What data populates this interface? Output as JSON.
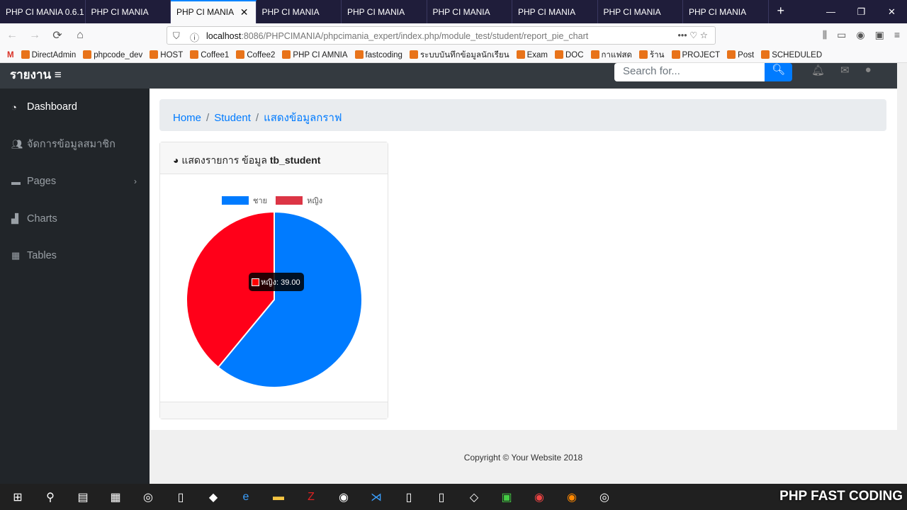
{
  "browser": {
    "tabs": [
      "PHP CI MANIA 0.6.1",
      "PHP CI MANIA",
      "PHP CI MANIA",
      "PHP CI MANIA",
      "PHP CI MANIA",
      "PHP CI MANIA",
      "PHP CI MANIA",
      "PHP CI MANIA",
      "PHP CI MANIA"
    ],
    "active_tab": 2,
    "url_host": "localhost",
    "url_rest": ":8086/PHPCIMANIA/phpcimania_expert/index.php/module_test/student/report_pie_chart",
    "bookmarks": [
      "DirectAdmin",
      "phpcode_dev",
      "HOST",
      "Coffee1",
      "Coffee2",
      "PHP CI AMNIA",
      "fastcoding",
      "ระบบบันทึกข้อมูลนักเรียน",
      "Exam",
      "DOC",
      "กาแฟสด",
      "ร้าน",
      "PROJECT",
      "Post",
      "SCHEDULED"
    ]
  },
  "topbar": {
    "brand": "รายงาน",
    "search_placeholder": "Search for..."
  },
  "sidebar": {
    "items": [
      {
        "label": "Dashboard",
        "icon": "tachometer-icon"
      },
      {
        "label": "จัดการข้อมูลสมาชิก",
        "icon": "users-icon"
      },
      {
        "label": "Pages",
        "icon": "folder-icon"
      },
      {
        "label": "Charts",
        "icon": "chart-area-icon"
      },
      {
        "label": "Tables",
        "icon": "table-icon"
      }
    ]
  },
  "breadcrumb": {
    "home": "Home",
    "student": "Student",
    "current": "แสดงข้อมูลกราฟ"
  },
  "card": {
    "title_prefix": "แสดงรายการ ข้อมูล",
    "title_bold": "tb_student"
  },
  "chart_data": {
    "type": "pie",
    "categories": [
      "ชาย",
      "หญิง"
    ],
    "values": [
      61,
      39
    ],
    "colors": [
      "#007bff",
      "#ff0019"
    ],
    "legend_colors": [
      "#007bff",
      "#dc3545"
    ],
    "legend": "top",
    "tooltip": "หญิง: 39.00"
  },
  "footer": {
    "copyright": "Copyright © Your Website 2018"
  },
  "watermark": "PHP FAST CODING"
}
